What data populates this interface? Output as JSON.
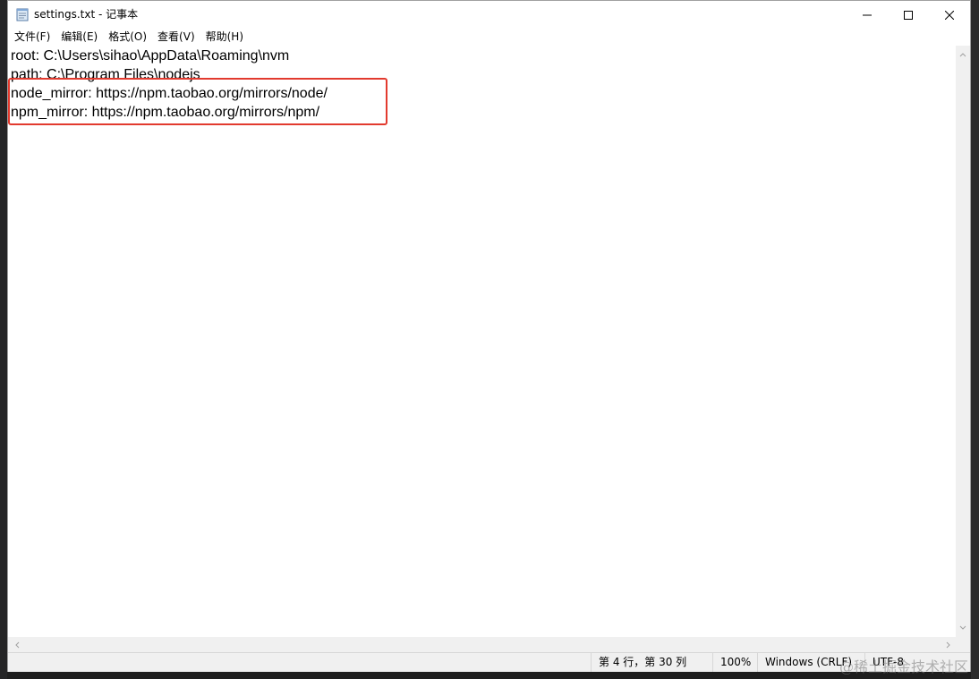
{
  "window": {
    "title": "settings.txt - 记事本"
  },
  "menu": [
    "文件(F)",
    "编辑(E)",
    "格式(O)",
    "查看(V)",
    "帮助(H)"
  ],
  "document": {
    "lines": [
      "root: C:\\Users\\sihao\\AppData\\Roaming\\nvm",
      "path: C:\\Program Files\\nodejs",
      "node_mirror: https://npm.taobao.org/mirrors/node/",
      "npm_mirror: https://npm.taobao.org/mirrors/npm/"
    ]
  },
  "status": {
    "position": "第 4 行，第 30 列",
    "zoom": "100%",
    "line_ending": "Windows (CRLF)",
    "encoding": "UTF-8"
  },
  "watermark": "@稀土掘金技术社区",
  "colors": {
    "highlight": "#e23a2e",
    "background": "#1e1e1e"
  },
  "icons": {
    "app": "notepad-icon",
    "minimize": "minimize-icon",
    "maximize": "maximize-icon",
    "close": "close-icon"
  }
}
